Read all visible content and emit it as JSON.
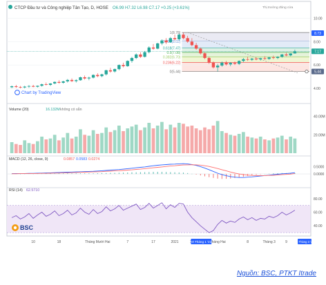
{
  "header": {
    "title": "CTCP Đầu tư và Công nghiệp Tân Tạo, D, HOSE",
    "ohlc": "O6.99  H7.32  L6.98  C7.17  +0.25 (+3.61%)",
    "market_status": "Thị trường đóng cửa",
    "chart_by": "Chart by TradingView",
    "source": "Nguồn: BSC, PTKT Itrade",
    "logo": "BSC"
  },
  "colors": {
    "up": "#26a69a",
    "down": "#ef5350",
    "macd": "#2962ff",
    "signal": "#ff6d6d",
    "rsi": "#7e57c2",
    "vol_up": "#9fd8c5",
    "vol_down": "#f5a9a9",
    "price_tag": "#26a69a",
    "last_tag": "#5b6b8c"
  },
  "chart_data": [
    {
      "type": "candlestick",
      "pane": "price",
      "x_labels": [
        "10",
        "18",
        "Tháng Mười Hai",
        "7",
        "17",
        "2021",
        "12",
        "Tháng Hai",
        "8",
        "Tháng 3",
        "9"
      ],
      "y_ticks": [
        10.0,
        8.0,
        6.0,
        4.0
      ],
      "ylim": [
        3.0,
        10.5
      ],
      "fib_levels": [
        {
          "ratio": "1",
          "value": 8.78
        },
        {
          "ratio": "0.786",
          "value": 8.02
        },
        {
          "ratio": "0.618",
          "value": 7.47
        },
        {
          "ratio": "0.5",
          "value": 7.08
        },
        {
          "ratio": "0.382",
          "value": 6.7
        },
        {
          "ratio": "0.236",
          "value": 6.22
        },
        {
          "ratio": "0",
          "value": 5.44
        }
      ],
      "right_tags": [
        "8.73",
        "7.17",
        "5.44"
      ],
      "candles": [
        [
          4.1,
          4.25,
          4.02,
          4.18
        ],
        [
          4.18,
          4.3,
          4.05,
          4.12
        ],
        [
          4.12,
          4.2,
          4.0,
          4.08
        ],
        [
          4.08,
          4.22,
          4.0,
          4.15
        ],
        [
          4.15,
          4.28,
          4.05,
          4.2
        ],
        [
          4.2,
          4.3,
          4.1,
          4.14
        ],
        [
          4.14,
          4.25,
          4.08,
          4.22
        ],
        [
          4.22,
          4.4,
          4.15,
          4.35
        ],
        [
          4.35,
          4.5,
          4.25,
          4.3
        ],
        [
          4.3,
          4.45,
          4.2,
          4.42
        ],
        [
          4.42,
          4.6,
          4.35,
          4.55
        ],
        [
          4.55,
          4.7,
          4.4,
          4.48
        ],
        [
          4.48,
          4.65,
          4.4,
          4.6
        ],
        [
          4.6,
          4.8,
          4.5,
          4.72
        ],
        [
          4.72,
          4.85,
          4.55,
          4.62
        ],
        [
          4.62,
          4.78,
          4.5,
          4.7
        ],
        [
          4.7,
          5.0,
          4.65,
          4.95
        ],
        [
          4.95,
          5.1,
          4.75,
          4.85
        ],
        [
          4.85,
          5.0,
          4.7,
          4.92
        ],
        [
          4.92,
          5.2,
          4.85,
          5.15
        ],
        [
          5.15,
          5.3,
          4.95,
          5.05
        ],
        [
          5.05,
          5.25,
          4.95,
          5.2
        ],
        [
          5.2,
          5.6,
          5.1,
          5.55
        ],
        [
          5.55,
          5.75,
          5.35,
          5.45
        ],
        [
          5.45,
          5.7,
          5.35,
          5.65
        ],
        [
          5.65,
          6.05,
          5.55,
          6.0
        ],
        [
          6.0,
          6.2,
          5.8,
          5.9
        ],
        [
          5.9,
          6.4,
          5.85,
          6.35
        ],
        [
          6.35,
          6.7,
          6.2,
          6.6
        ],
        [
          6.6,
          7.0,
          6.5,
          6.9
        ],
        [
          6.9,
          7.1,
          6.6,
          6.7
        ],
        [
          6.7,
          7.2,
          6.65,
          7.1
        ],
        [
          7.1,
          7.6,
          7.0,
          7.5
        ],
        [
          7.5,
          7.8,
          7.3,
          7.4
        ],
        [
          7.4,
          7.9,
          7.35,
          7.85
        ],
        [
          7.85,
          8.2,
          7.7,
          8.1
        ],
        [
          8.1,
          8.3,
          7.8,
          7.95
        ],
        [
          7.95,
          8.4,
          7.9,
          8.3
        ],
        [
          8.3,
          8.6,
          8.1,
          8.2
        ],
        [
          8.2,
          8.7,
          8.1,
          8.6
        ],
        [
          8.6,
          8.78,
          8.2,
          8.3
        ],
        [
          8.3,
          8.5,
          7.9,
          8.0
        ],
        [
          8.0,
          8.3,
          7.6,
          7.7
        ],
        [
          7.7,
          7.9,
          7.3,
          7.4
        ],
        [
          7.4,
          7.5,
          6.9,
          7.0
        ],
        [
          7.0,
          7.1,
          6.5,
          6.6
        ],
        [
          6.6,
          6.7,
          6.1,
          6.2
        ],
        [
          6.2,
          6.3,
          5.7,
          5.8
        ],
        [
          5.8,
          6.1,
          5.44,
          5.95
        ],
        [
          5.95,
          6.3,
          5.85,
          6.2
        ],
        [
          6.2,
          6.35,
          5.95,
          6.05
        ],
        [
          6.05,
          6.25,
          5.9,
          6.18
        ],
        [
          6.18,
          6.3,
          6.0,
          6.1
        ],
        [
          6.1,
          6.4,
          6.0,
          6.35
        ],
        [
          6.35,
          6.6,
          6.25,
          6.5
        ],
        [
          6.5,
          6.7,
          6.35,
          6.45
        ],
        [
          6.45,
          6.6,
          6.35,
          6.55
        ],
        [
          6.55,
          6.65,
          6.4,
          6.48
        ],
        [
          6.48,
          6.62,
          6.38,
          6.58
        ],
        [
          6.58,
          6.75,
          6.45,
          6.52
        ],
        [
          6.52,
          6.7,
          6.45,
          6.65
        ],
        [
          6.65,
          6.8,
          6.5,
          6.6
        ],
        [
          6.6,
          6.75,
          6.5,
          6.7
        ],
        [
          6.7,
          6.95,
          6.62,
          6.9
        ],
        [
          6.9,
          7.05,
          6.75,
          6.82
        ],
        [
          6.82,
          7.0,
          6.75,
          6.99
        ],
        [
          6.99,
          7.32,
          6.98,
          7.17
        ]
      ]
    },
    {
      "type": "bar",
      "pane": "volume",
      "label": "Volume (20)",
      "value_text": "16.132M",
      "extra": "không có sẵn",
      "y_ticks": [
        "40.00M",
        "20.00M"
      ],
      "ylim": [
        0,
        45
      ],
      "values": [
        12,
        10,
        9,
        14,
        11,
        10,
        13,
        18,
        15,
        16,
        20,
        14,
        17,
        22,
        16,
        18,
        26,
        20,
        19,
        25,
        21,
        22,
        28,
        23,
        25,
        30,
        24,
        27,
        29,
        31,
        25,
        28,
        33,
        27,
        30,
        34,
        26,
        31,
        28,
        33,
        32,
        29,
        30,
        27,
        25,
        28,
        26,
        30,
        35,
        24,
        22,
        20,
        19,
        21,
        23,
        18,
        17,
        16,
        18,
        15,
        14,
        16,
        17,
        19,
        15,
        18,
        16
      ]
    },
    {
      "type": "line",
      "pane": "macd",
      "label": "MACD (12, 26, close, 9)",
      "values_text": [
        "0.0857",
        "0.0583",
        "0.0274"
      ],
      "y_ticks": [
        "0.5000",
        "0.0000"
      ],
      "ylim": [
        -0.75,
        0.85
      ],
      "series": [
        {
          "name": "MACD",
          "values": [
            0.02,
            0.03,
            0.02,
            0.03,
            0.04,
            0.04,
            0.05,
            0.06,
            0.07,
            0.08,
            0.09,
            0.1,
            0.11,
            0.12,
            0.13,
            0.14,
            0.15,
            0.16,
            0.17,
            0.18,
            0.2,
            0.22,
            0.24,
            0.26,
            0.28,
            0.3,
            0.33,
            0.36,
            0.39,
            0.42,
            0.45,
            0.48,
            0.52,
            0.56,
            0.59,
            0.62,
            0.64,
            0.66,
            0.67,
            0.69,
            0.7,
            0.68,
            0.64,
            0.58,
            0.5,
            0.4,
            0.29,
            0.17,
            0.05,
            -0.05,
            -0.12,
            -0.18,
            -0.22,
            -0.24,
            -0.24,
            -0.22,
            -0.2,
            -0.17,
            -0.14,
            -0.11,
            -0.08,
            -0.05,
            -0.02,
            0.01,
            0.03,
            0.05,
            0.09
          ]
        },
        {
          "name": "Signal",
          "values": [
            0.01,
            0.01,
            0.02,
            0.02,
            0.02,
            0.03,
            0.03,
            0.04,
            0.04,
            0.05,
            0.06,
            0.06,
            0.07,
            0.08,
            0.09,
            0.1,
            0.11,
            0.12,
            0.13,
            0.14,
            0.15,
            0.16,
            0.18,
            0.19,
            0.21,
            0.22,
            0.24,
            0.26,
            0.28,
            0.31,
            0.33,
            0.36,
            0.39,
            0.42,
            0.45,
            0.48,
            0.51,
            0.54,
            0.56,
            0.59,
            0.61,
            0.62,
            0.63,
            0.62,
            0.6,
            0.56,
            0.51,
            0.44,
            0.37,
            0.29,
            0.21,
            0.13,
            0.06,
            0.0,
            -0.05,
            -0.08,
            -0.1,
            -0.11,
            -0.11,
            -0.11,
            -0.1,
            -0.09,
            -0.07,
            -0.05,
            -0.03,
            -0.01,
            0.03
          ]
        },
        {
          "name": "Histogram",
          "values": [
            0.01,
            0.02,
            0.0,
            0.01,
            0.02,
            0.01,
            0.02,
            0.02,
            0.03,
            0.03,
            0.03,
            0.04,
            0.04,
            0.04,
            0.04,
            0.04,
            0.04,
            0.04,
            0.04,
            0.04,
            0.05,
            0.06,
            0.06,
            0.07,
            0.07,
            0.08,
            0.09,
            0.1,
            0.11,
            0.11,
            0.12,
            0.12,
            0.13,
            0.14,
            0.14,
            0.14,
            0.13,
            0.12,
            0.11,
            0.1,
            0.09,
            0.06,
            0.01,
            -0.04,
            -0.1,
            -0.16,
            -0.22,
            -0.27,
            -0.32,
            -0.34,
            -0.33,
            -0.31,
            -0.28,
            -0.24,
            -0.19,
            -0.14,
            -0.1,
            -0.06,
            -0.03,
            0.0,
            0.02,
            0.04,
            0.05,
            0.06,
            0.06,
            0.06,
            0.06
          ]
        }
      ]
    },
    {
      "type": "line",
      "pane": "rsi",
      "label": "RSI (14)",
      "value_text": "62.5710",
      "y_ticks": [
        "80.00",
        "60.00",
        "40.00"
      ],
      "ylim": [
        25,
        90
      ],
      "band": [
        30,
        70
      ],
      "values": [
        52,
        55,
        50,
        53,
        58,
        51,
        56,
        60,
        54,
        57,
        62,
        55,
        58,
        63,
        56,
        59,
        66,
        60,
        57,
        64,
        58,
        61,
        68,
        62,
        65,
        70,
        63,
        66,
        69,
        72,
        64,
        67,
        73,
        66,
        70,
        74,
        65,
        71,
        67,
        73,
        72,
        60,
        52,
        46,
        40,
        35,
        30,
        33,
        42,
        48,
        44,
        47,
        45,
        50,
        53,
        49,
        52,
        48,
        51,
        50,
        54,
        52,
        55,
        60,
        56,
        59,
        63
      ]
    }
  ],
  "time_axis": {
    "labels": [
      "10",
      "18",
      "Tháng Mười Hai",
      "7",
      "17",
      "2021",
      "12",
      "Tháng Hai",
      "8",
      "Tháng 3",
      "9"
    ],
    "highlight_left": "Vt Tháng 1 '21",
    "highlight_right": "Vt Tháng 3 '21"
  }
}
